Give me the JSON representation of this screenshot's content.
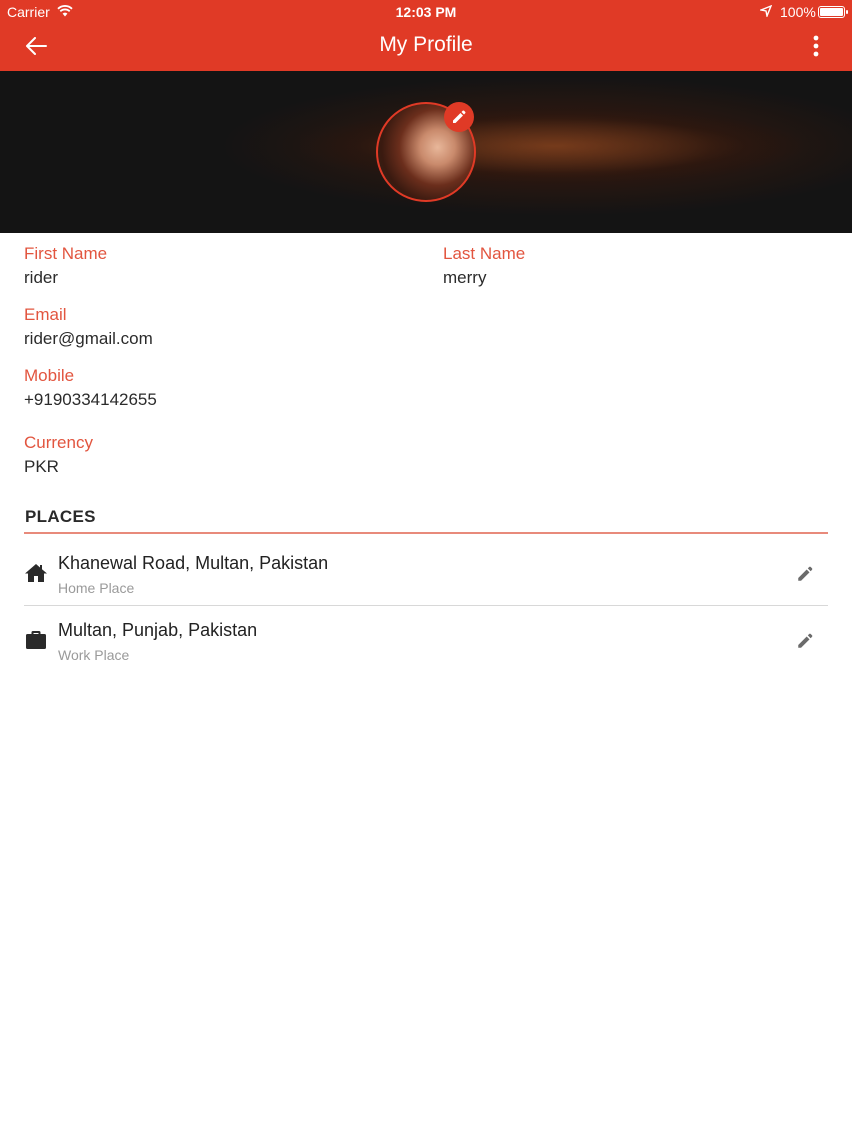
{
  "status_bar": {
    "carrier": "Carrier",
    "time": "12:03 PM",
    "battery": "100%"
  },
  "header": {
    "title": "My Profile",
    "back_icon": "arrow-left-icon",
    "menu_icon": "more-vertical-icon",
    "color": "#e03a26"
  },
  "profile": {
    "first_name_label": "First Name",
    "first_name": "rider",
    "last_name_label": "Last Name",
    "last_name": "merry",
    "email_label": "Email",
    "email": "rider@gmail.com",
    "mobile_label": "Mobile",
    "mobile": "+9190334142655",
    "currency_label": "Currency",
    "currency": "PKR"
  },
  "places": {
    "heading": "PLACES",
    "items": [
      {
        "icon": "home-icon",
        "address": "Khanewal Road,  Multan,  Pakistan",
        "type": "Home Place"
      },
      {
        "icon": "briefcase-icon",
        "address": "Multan, Punjab, Pakistan",
        "type": "Work Place"
      }
    ]
  },
  "colors": {
    "accent": "#e03a26",
    "label": "#e2553f"
  }
}
